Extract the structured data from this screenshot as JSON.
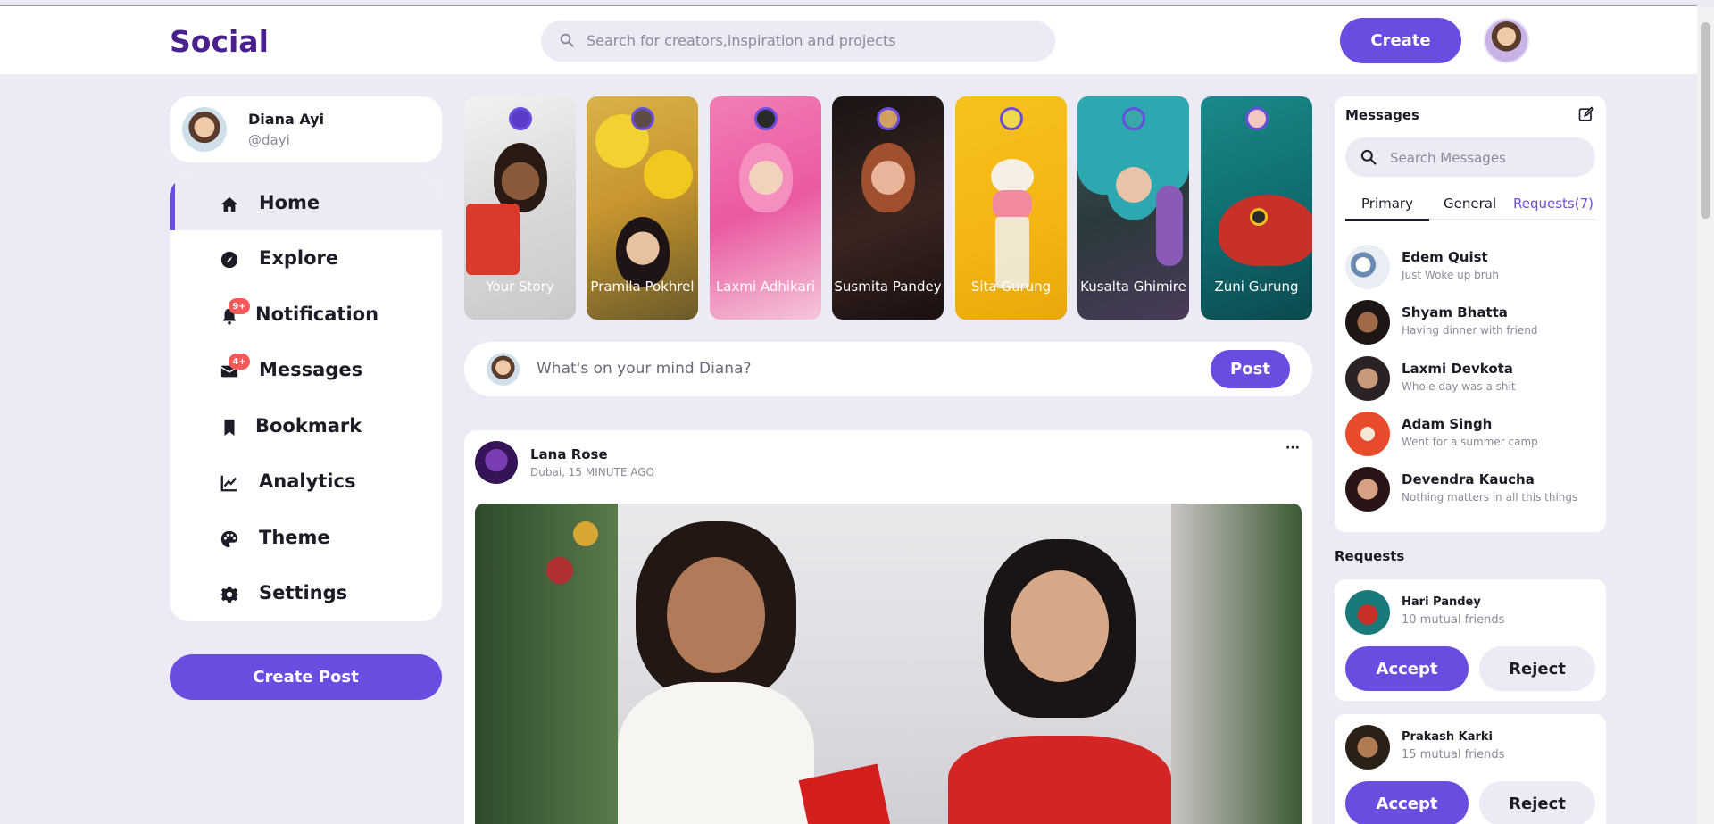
{
  "app": {
    "logo": "Social"
  },
  "header": {
    "search_placeholder": "Search for creators,inspiration and projects",
    "create_label": "Create"
  },
  "profile": {
    "name": "Diana Ayi",
    "handle": "@dayi"
  },
  "sidebar": {
    "items": [
      {
        "label": "Home",
        "icon": "home-icon",
        "active": true
      },
      {
        "label": "Explore",
        "icon": "compass-icon"
      },
      {
        "label": "Notification",
        "icon": "bell-icon",
        "badge": "9+"
      },
      {
        "label": "Messages",
        "icon": "envelope-icon",
        "badge": "4+"
      },
      {
        "label": "Bookmark",
        "icon": "bookmark-icon"
      },
      {
        "label": "Analytics",
        "icon": "chart-icon"
      },
      {
        "label": "Theme",
        "icon": "palette-icon"
      },
      {
        "label": "Settings",
        "icon": "gear-icon"
      }
    ],
    "create_post_label": "Create Post"
  },
  "stories": [
    {
      "name": "Your Story"
    },
    {
      "name": "Pramila Pokhrel"
    },
    {
      "name": "Laxmi Adhikari"
    },
    {
      "name": "Susmita Pandey"
    },
    {
      "name": "Sita Gurung"
    },
    {
      "name": "Kusalta Ghimire"
    },
    {
      "name": "Zuni Gurung"
    }
  ],
  "composer": {
    "placeholder": "What's on your mind Diana?",
    "post_label": "Post"
  },
  "feed": [
    {
      "author": "Lana Rose",
      "meta": "Dubai, 15 MINUTE AGO",
      "menu": "···"
    }
  ],
  "messages": {
    "title": "Messages",
    "search_placeholder": "Search Messages",
    "tabs": [
      {
        "label": "Primary",
        "active": true
      },
      {
        "label": "General"
      },
      {
        "label": "Requests(7)"
      }
    ],
    "items": [
      {
        "name": "Edem Quist",
        "text": "Just Woke up bruh"
      },
      {
        "name": "Shyam Bhatta",
        "text": "Having dinner with friend"
      },
      {
        "name": "Laxmi Devkota",
        "text": "Whole day was a shit"
      },
      {
        "name": "Adam Singh",
        "text": "Went for a summer camp"
      },
      {
        "name": "Devendra Kaucha",
        "text": "Nothing matters in all this things"
      }
    ]
  },
  "requests": {
    "title": "Requests",
    "items": [
      {
        "name": "Hari Pandey",
        "mutual": "10 mutual friends",
        "accept": "Accept",
        "reject": "Reject"
      },
      {
        "name": "Prakash Karki",
        "mutual": "15 mutual friends",
        "accept": "Accept",
        "reject": "Reject"
      }
    ]
  },
  "colors": {
    "accent": "#6b4ce0",
    "logo": "#4a1f8e",
    "background": "#ecebf5",
    "badge": "#f45a5a"
  }
}
